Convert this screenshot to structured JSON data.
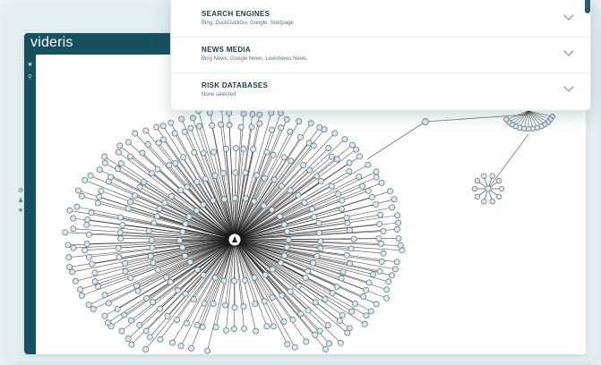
{
  "app": {
    "brand": "videris"
  },
  "rail": {
    "icons": [
      "star-icon",
      "search-icon"
    ]
  },
  "tools": {
    "icons": [
      "gear-icon",
      "person-icon",
      "star-icon"
    ]
  },
  "filters": [
    {
      "title": "SEARCH ENGINES",
      "value": "Bing, DuckDuckGo, Google, Startpage"
    },
    {
      "title": "NEWS MEDIA",
      "value": "Bing News, Google News, LexisNexis News"
    },
    {
      "title": "RISK DATABASES",
      "value": "None selected"
    }
  ],
  "graph": {
    "center_node_icon": "person-icon",
    "secondary_clusters": 2
  },
  "colors": {
    "brand": "#17505f",
    "node_fill": "#dce8ec",
    "node_stroke": "#4f6e7a",
    "edge": "#1a1a1a"
  }
}
